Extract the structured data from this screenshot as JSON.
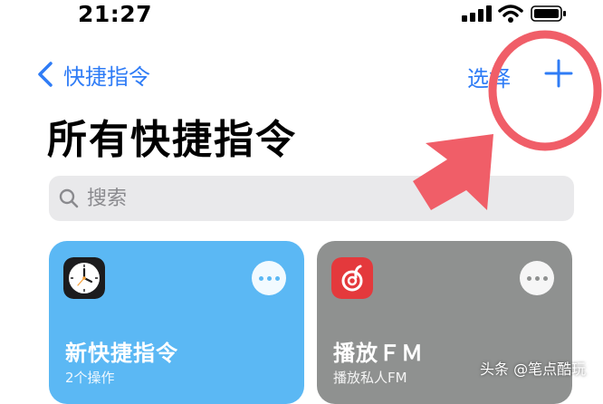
{
  "status_bar": {
    "time": "21:27"
  },
  "nav": {
    "back_label": "快捷指令",
    "select_label": "选择"
  },
  "page": {
    "title": "所有快捷指令"
  },
  "search": {
    "placeholder": "搜索"
  },
  "cards": [
    {
      "title": "新快捷指令",
      "subtitle": "2个操作",
      "icon": "clock-icon",
      "color": "#5bb8f4"
    },
    {
      "title": "播放ＦＭ",
      "subtitle": "播放私人FM",
      "icon": "netease-music-icon",
      "color": "#8f9190"
    }
  ],
  "watermark": "头条 @笔点酷玩",
  "colors": {
    "accent": "#2f7cf6",
    "annotation": "#f05e68",
    "search_bg": "#e9e9eb"
  }
}
